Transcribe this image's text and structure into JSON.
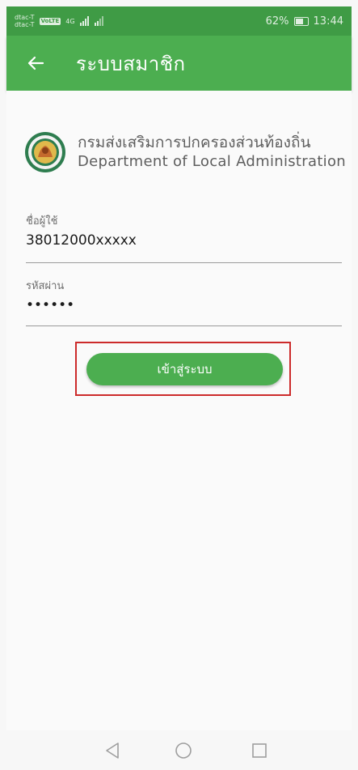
{
  "status_bar": {
    "carrier1": "dtac-T",
    "carrier2": "dtac-T",
    "volte": "VoLTE",
    "network": "4G",
    "battery_percent": "62%",
    "battery_level": 0.62,
    "time": "13:44"
  },
  "app_bar": {
    "title": "ระบบสมาชิก",
    "back_icon": "arrow-left-icon",
    "color": "#4cae50"
  },
  "organization": {
    "logo_icon": "dla-emblem-icon",
    "name_th": "กรมส่งเสริมการปกครองส่วนท้องถิ่น",
    "name_en": "Department of Local Administration"
  },
  "form": {
    "username_label": "ชื่อผู้ใช้",
    "username_value": "38012000xxxxx",
    "password_label": "รหัสผ่าน",
    "password_value": "••••••",
    "login_button": "เข้าสู่ระบบ"
  },
  "nav": {
    "back_icon": "triangle-back-icon",
    "home_icon": "circle-home-icon",
    "recents_icon": "square-recents-icon"
  }
}
